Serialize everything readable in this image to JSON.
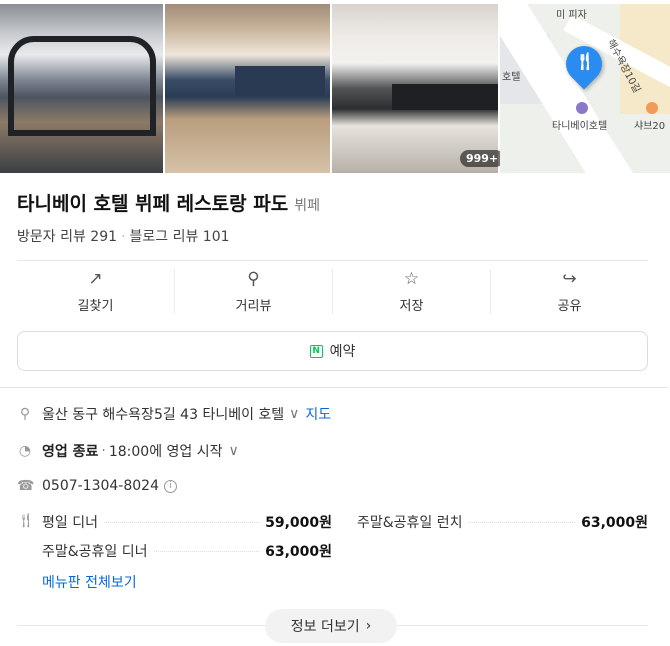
{
  "photos": {
    "more_count": "999+",
    "map": {
      "labels": [
        "미 피자",
        "해수욕장10길",
        "호텔",
        "타니베이호텔",
        "샤브20"
      ]
    }
  },
  "place": {
    "name": "타니베이 호텔 뷔페 레스토랑 파도",
    "category": "뷔페",
    "visitor_reviews": "방문자 리뷰 291",
    "blog_reviews": "블로그 리뷰 101"
  },
  "actions": [
    {
      "label": "길찾기",
      "icon": "directions-icon"
    },
    {
      "label": "거리뷰",
      "icon": "street-view-icon"
    },
    {
      "label": "저장",
      "icon": "star-icon"
    },
    {
      "label": "공유",
      "icon": "share-icon"
    }
  ],
  "reserve": {
    "label": "예약",
    "brand_color": "#03c75a"
  },
  "info": {
    "address": "울산 동구 해수욕장5길 43 타니베이 호텔",
    "map_link": "지도",
    "status": "영업 종료",
    "hours_note": "18:00에 영업 시작",
    "phone": "0507-1304-8024"
  },
  "menu": {
    "items": [
      {
        "name": "평일 디너",
        "price": "59,000원"
      },
      {
        "name": "주말&공휴일 런치",
        "price": "63,000원"
      },
      {
        "name": "주말&공휴일 디너",
        "price": "63,000원"
      }
    ],
    "view_all": "메뉴판 전체보기"
  },
  "more_info": "정보 더보기",
  "colors": {
    "link": "#0a6ad4",
    "pin": "#2a8cf0"
  }
}
